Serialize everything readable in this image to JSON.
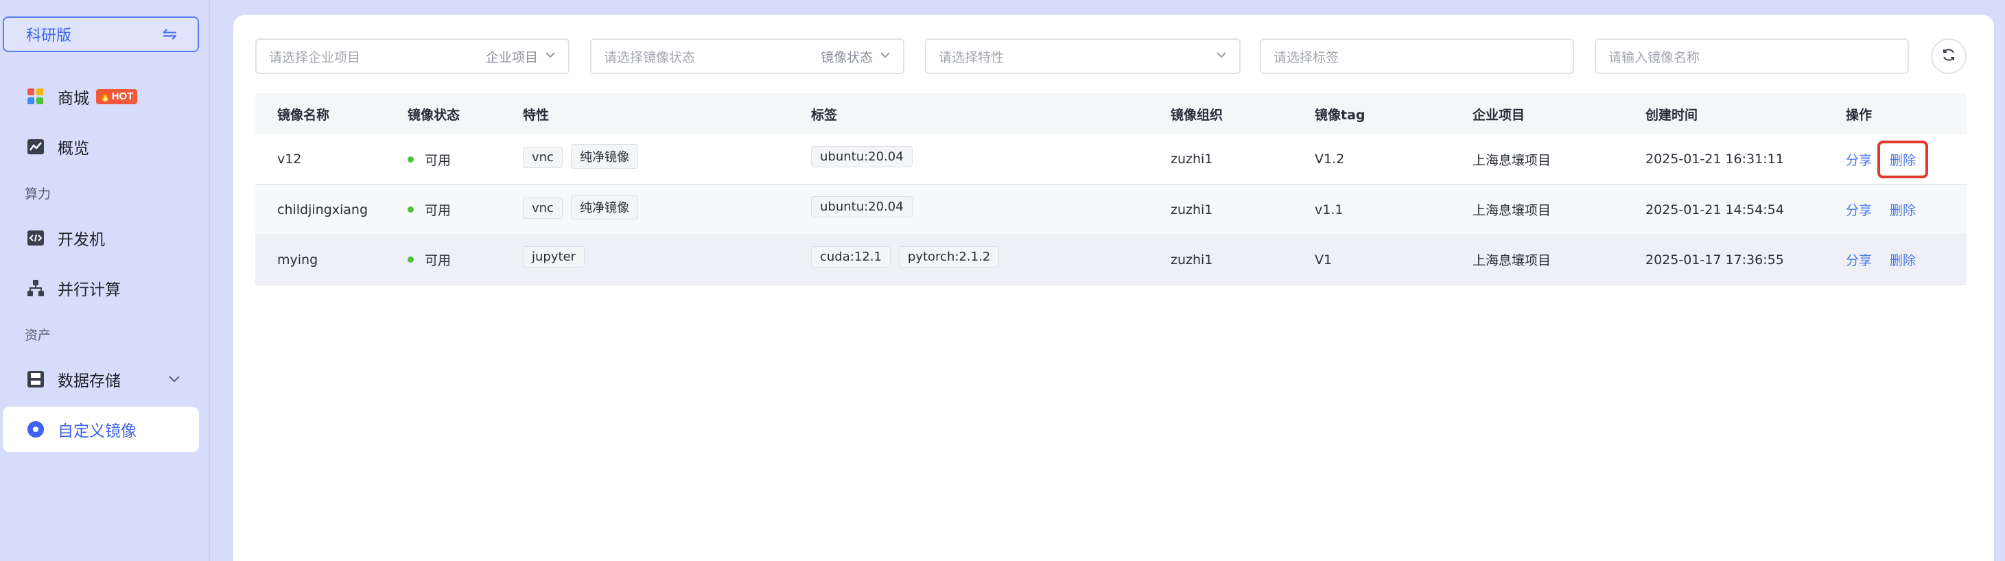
{
  "sidebar": {
    "edition_label": "科研版",
    "swap_symbol": "⇋",
    "hot_badge": "HOT",
    "items": [
      {
        "label": "商城",
        "icon": "store-icon"
      },
      {
        "label": "概览",
        "icon": "chart-icon"
      },
      {
        "label": "开发机",
        "icon": "code-icon"
      },
      {
        "label": "并行计算",
        "icon": "hierarchy-icon"
      },
      {
        "label": "数据存储",
        "icon": "disk-icon"
      },
      {
        "label": "自定义镜像",
        "icon": "image-icon"
      }
    ],
    "sections": {
      "compute": "算力",
      "assets": "资产"
    }
  },
  "filters": {
    "project": {
      "placeholder": "请选择企业项目",
      "label": "企业项目"
    },
    "status": {
      "placeholder": "请选择镜像状态",
      "label": "镜像状态"
    },
    "feature": {
      "placeholder": "请选择特性"
    },
    "tag": {
      "placeholder": "请选择标签"
    },
    "name": {
      "placeholder": "请输入镜像名称"
    }
  },
  "table": {
    "headers": {
      "name": "镜像名称",
      "status": "镜像状态",
      "features": "特性",
      "tags": "标签",
      "org": "镜像组织",
      "tag": "镜像tag",
      "project": "企业项目",
      "created": "创建时间",
      "ops": "操作"
    },
    "rows": [
      {
        "name": "v12",
        "status": "可用",
        "features": [
          "vnc",
          "纯净镜像"
        ],
        "tags": [
          "ubuntu:20.04"
        ],
        "org": "zuzhi1",
        "tag": "V1.2",
        "project": "上海息壤项目",
        "created": "2025-01-21 16:31:11",
        "share": "分享",
        "delete": "删除"
      },
      {
        "name": "childjingxiang",
        "status": "可用",
        "features": [
          "vnc",
          "纯净镜像"
        ],
        "tags": [
          "ubuntu:20.04"
        ],
        "org": "zuzhi1",
        "tag": "v1.1",
        "project": "上海息壤项目",
        "created": "2025-01-21 14:54:54",
        "share": "分享",
        "delete": "删除"
      },
      {
        "name": "mying",
        "status": "可用",
        "features": [
          "jupyter"
        ],
        "tags": [
          "cuda:12.1",
          "pytorch:2.1.2"
        ],
        "org": "zuzhi1",
        "tag": "V1",
        "project": "上海息壤项目",
        "created": "2025-01-17 17:36:55",
        "share": "分享",
        "delete": "删除"
      }
    ]
  },
  "colors": {
    "accent": "#3d63ef",
    "status_ok": "#4cc23a",
    "link": "#4a78f0",
    "highlight_box": "#e03a2a"
  }
}
